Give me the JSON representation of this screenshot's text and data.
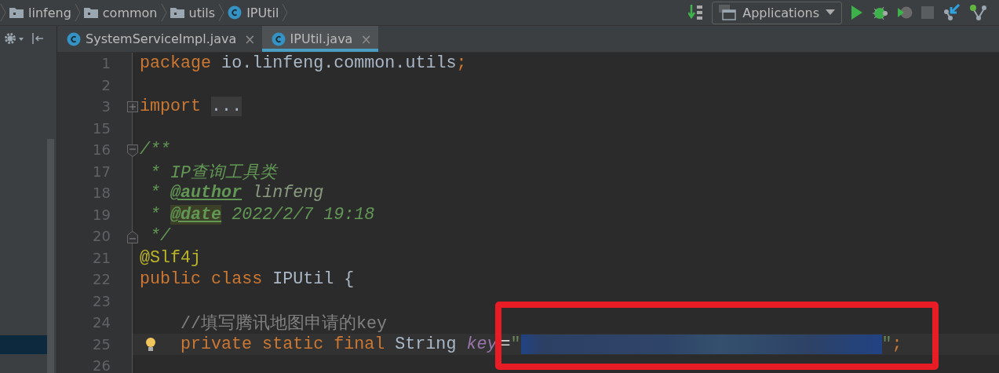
{
  "breadcrumbs": [
    {
      "label": "linfeng",
      "kind": "folder"
    },
    {
      "label": "common",
      "kind": "folder"
    },
    {
      "label": "utils",
      "kind": "folder"
    },
    {
      "label": "IPUtil",
      "kind": "class"
    }
  ],
  "run_config": {
    "label": "Applications"
  },
  "tabs": [
    {
      "label": "SystemServiceImpl.java",
      "selected": false,
      "close": "×"
    },
    {
      "label": "IPUtil.java",
      "selected": true,
      "close": "×"
    }
  ],
  "lines": [
    {
      "number": "1",
      "current": false,
      "indented": false,
      "tokens": [
        {
          "kind": "keyword",
          "text": "package"
        },
        {
          "kind": "plain",
          "text": " io.linfeng.common.utils"
        },
        {
          "kind": "keyword",
          "text": ";"
        }
      ]
    },
    {
      "number": "2",
      "current": false
    },
    {
      "number": "3",
      "current": false,
      "indented": false,
      "fold": {
        "kind": "expand"
      },
      "tokens": [
        {
          "kind": "keyword",
          "text": "import "
        },
        {
          "kind": "folded",
          "text": "..."
        }
      ]
    },
    {
      "number": "15",
      "current": false
    },
    {
      "number": "16",
      "current": false,
      "indented": false,
      "fold": {
        "kind": "start"
      },
      "tokens": [
        {
          "kind": "doc",
          "text": "/**"
        }
      ]
    },
    {
      "number": "17",
      "current": false,
      "indented": false,
      "tokens": [
        {
          "kind": "doc",
          "text": " * IP查询工具类"
        }
      ]
    },
    {
      "number": "18",
      "current": false,
      "indented": false,
      "tokens": [
        {
          "kind": "doc",
          "text": " * "
        },
        {
          "kind": "doctag",
          "text": "@author"
        },
        {
          "kind": "docvalue",
          "text": " linfeng"
        }
      ]
    },
    {
      "number": "19",
      "current": false,
      "indented": false,
      "tokens": [
        {
          "kind": "doc",
          "text": " * "
        },
        {
          "kind": "doctag-match",
          "text": "@date"
        },
        {
          "kind": "doc",
          "text": " 2022/2/7 19:18"
        }
      ]
    },
    {
      "number": "20",
      "current": false,
      "indented": false,
      "fold": {
        "kind": "end"
      },
      "tokens": [
        {
          "kind": "doc",
          "text": " */"
        }
      ]
    },
    {
      "number": "21",
      "current": false,
      "indented": false,
      "tokens": [
        {
          "kind": "annotation",
          "text": "@Slf4j"
        }
      ]
    },
    {
      "number": "22",
      "current": false,
      "indented": false,
      "tokens": [
        {
          "kind": "keyword",
          "text": "public class"
        },
        {
          "kind": "plain",
          "text": " IPUtil {"
        }
      ]
    },
    {
      "number": "23",
      "current": false
    },
    {
      "number": "24",
      "current": false,
      "indented": true,
      "tokens": [
        {
          "kind": "comment",
          "text": "//填写腾讯地图申请的key"
        }
      ]
    },
    {
      "number": "25",
      "current": true,
      "indented": true,
      "tokens": [
        {
          "kind": "keyword",
          "text": "private static final"
        },
        {
          "kind": "plain",
          "text": " String "
        },
        {
          "kind": "field",
          "text": "key"
        },
        {
          "kind": "operator",
          "text": "="
        },
        {
          "kind": "string",
          "text": "\""
        },
        {
          "kind": "redacted"
        },
        {
          "kind": "string",
          "text": "\""
        },
        {
          "kind": "keyword",
          "text": ";"
        }
      ]
    },
    {
      "number": "26",
      "current": false
    }
  ]
}
